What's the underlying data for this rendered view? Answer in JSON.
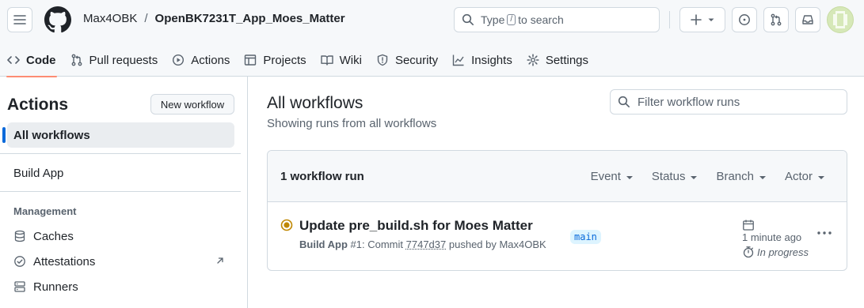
{
  "header": {
    "owner": "Max4OBK",
    "separator": "/",
    "repo": "OpenBK7231T_App_Moes_Matter",
    "search": {
      "prefix": "Type",
      "key": "/",
      "suffix": "to search"
    },
    "icons": [
      "hamburger-icon",
      "github-logo",
      "search-icon",
      "plus-icon",
      "issue-icon",
      "pull-request-icon",
      "inbox-icon",
      "avatar"
    ]
  },
  "tabs": [
    {
      "label": "Code",
      "icon": "code-icon",
      "selected": true
    },
    {
      "label": "Pull requests",
      "icon": "pull-request-icon"
    },
    {
      "label": "Actions",
      "icon": "play-icon"
    },
    {
      "label": "Projects",
      "icon": "table-icon"
    },
    {
      "label": "Wiki",
      "icon": "book-icon"
    },
    {
      "label": "Security",
      "icon": "shield-icon"
    },
    {
      "label": "Insights",
      "icon": "graph-icon"
    },
    {
      "label": "Settings",
      "icon": "gear-icon"
    }
  ],
  "sidebar": {
    "title": "Actions",
    "new_workflow": "New workflow",
    "all_workflows": "All workflows",
    "workflows": [
      "Build App"
    ],
    "section": "Management",
    "management": [
      {
        "label": "Caches",
        "icon": "database-icon"
      },
      {
        "label": "Attestations",
        "icon": "verified-icon",
        "external": true
      },
      {
        "label": "Runners",
        "icon": "server-icon"
      }
    ]
  },
  "main": {
    "title": "All workflows",
    "subtitle": "Showing runs from all workflows",
    "filter_placeholder": "Filter workflow runs",
    "run_count": "1 workflow run",
    "filters": [
      "Event",
      "Status",
      "Branch",
      "Actor"
    ],
    "run": {
      "title": "Update pre_build.sh for Moes Matter",
      "workflow": "Build App",
      "number": "#1",
      "commit_prefix": ": Commit",
      "commit": "7747d37",
      "pushed_by": "pushed by Max4OBK",
      "branch": "main",
      "time_ago": "1 minute ago",
      "status": "In progress",
      "status_color": "#bf8700"
    }
  },
  "colors": {
    "accent": "#0969da",
    "tab_underline": "#fd8c73",
    "border": "#d1d9e0"
  }
}
